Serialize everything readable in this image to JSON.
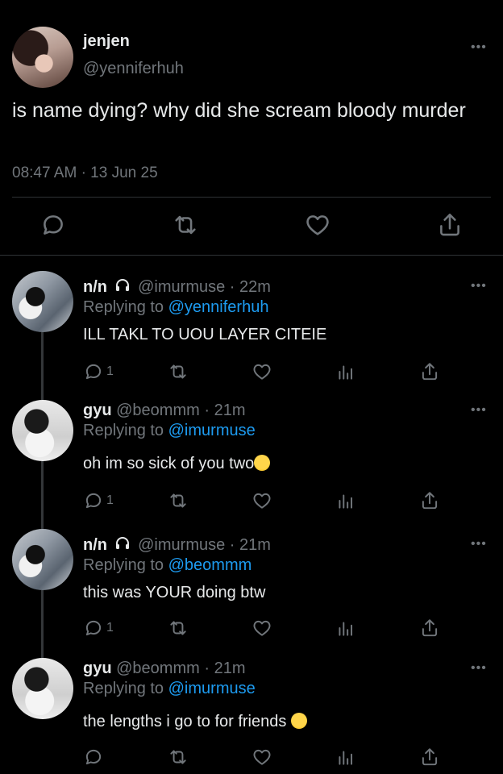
{
  "main_tweet": {
    "name": "jenjen",
    "handle": "@yenniferhuh",
    "text": "is name dying? why did she scream bloody murder",
    "time": "08:47 AM",
    "date": "13 Jun 25",
    "more_icon": "more-dots-icon"
  },
  "replies": [
    {
      "name": "n/n",
      "handle": "@imurmuse",
      "time": "22m",
      "replying_prefix": "Replying to",
      "mention": "@yenniferhuh",
      "text": "ILL TAKL TO UOU LAYER CITEIE",
      "reply_count": "1",
      "avatar": "nn"
    },
    {
      "name": "gyu",
      "handle": "@beommm",
      "time": "21m",
      "replying_prefix": "Replying to",
      "mention": "@imurmuse",
      "text": "oh im so sick of you two",
      "emoji": "crying-face-emoji",
      "reply_count": "1",
      "avatar": "gyu"
    },
    {
      "name": "n/n",
      "handle": "@imurmuse",
      "time": "21m",
      "replying_prefix": "Replying to",
      "mention": "@beommm",
      "text": "this was YOUR doing btw",
      "reply_count": "1",
      "avatar": "nn"
    },
    {
      "name": "gyu",
      "handle": "@beommm",
      "time": "21m",
      "replying_prefix": "Replying to",
      "mention": "@imurmuse",
      "text": "the lengths i go to for friends",
      "emoji": "hand-over-mouth-emoji",
      "reply_count": "",
      "avatar": "gyu"
    }
  ],
  "colors": {
    "background": "#000000",
    "text": "#e7e9ea",
    "secondary": "#71767b",
    "accent": "#1d9bf0",
    "divider": "#2f3336"
  },
  "separator": "·"
}
